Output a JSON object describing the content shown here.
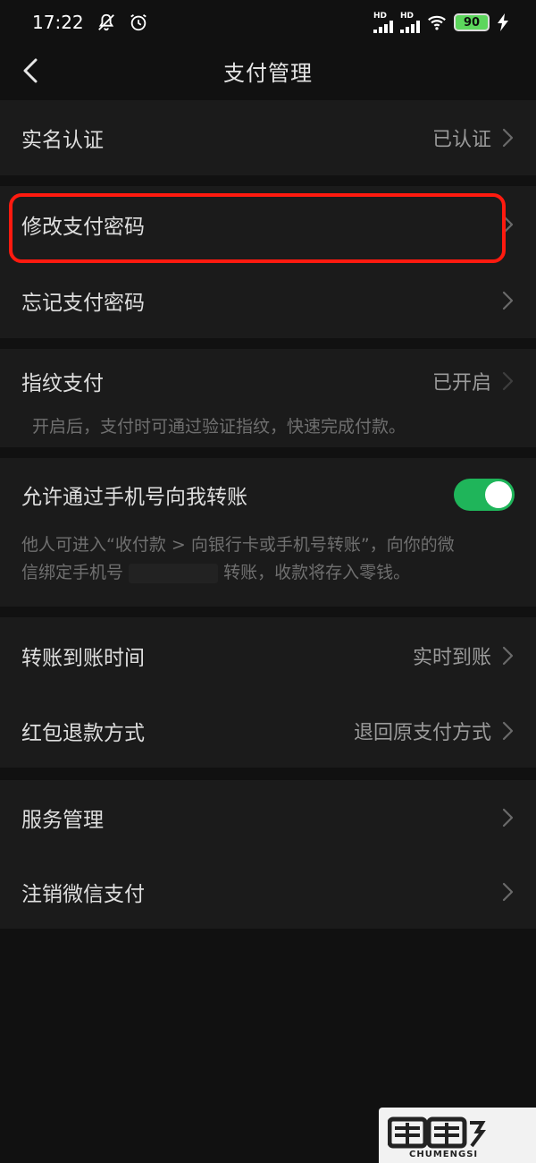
{
  "status_bar": {
    "time": "17:22",
    "hd_label_1": "HD",
    "hd_label_2": "HD",
    "battery": "90"
  },
  "nav": {
    "title": "支付管理"
  },
  "group1": {
    "real_name": {
      "label": "实名认证",
      "value": "已认证"
    }
  },
  "group2": {
    "change_password": {
      "label": "修改支付密码"
    },
    "forgot_password": {
      "label": "忘记支付密码"
    }
  },
  "group3": {
    "fingerprint": {
      "label": "指纹支付",
      "value": "已开启",
      "desc": "开启后，支付时可通过验证指纹，快速完成付款。"
    }
  },
  "group4": {
    "phone_transfer": {
      "label": "允许通过手机号向我转账",
      "toggle_on": true,
      "desc_line1": "他人可进入“收付款 > 向银行卡或手机号转账”，向你的微",
      "desc_line2": "信绑定手机号",
      "desc_line2_tail": "转账，收款将存入零钱。"
    }
  },
  "group5": {
    "arrival_time": {
      "label": "转账到账时间",
      "value": "实时到账"
    },
    "refund_method": {
      "label": "红包退款方式",
      "value": "退回原支付方式"
    }
  },
  "group6": {
    "service_mgmt": {
      "label": "服务管理"
    },
    "cancel_pay": {
      "label": "注销微信支付"
    }
  },
  "watermark": {
    "sub": "CHUMENGSI"
  },
  "colors": {
    "accent_green": "#1fb55a",
    "highlight_red": "#ff1a0f",
    "background": "#111111",
    "cell": "#1b1b1b"
  }
}
